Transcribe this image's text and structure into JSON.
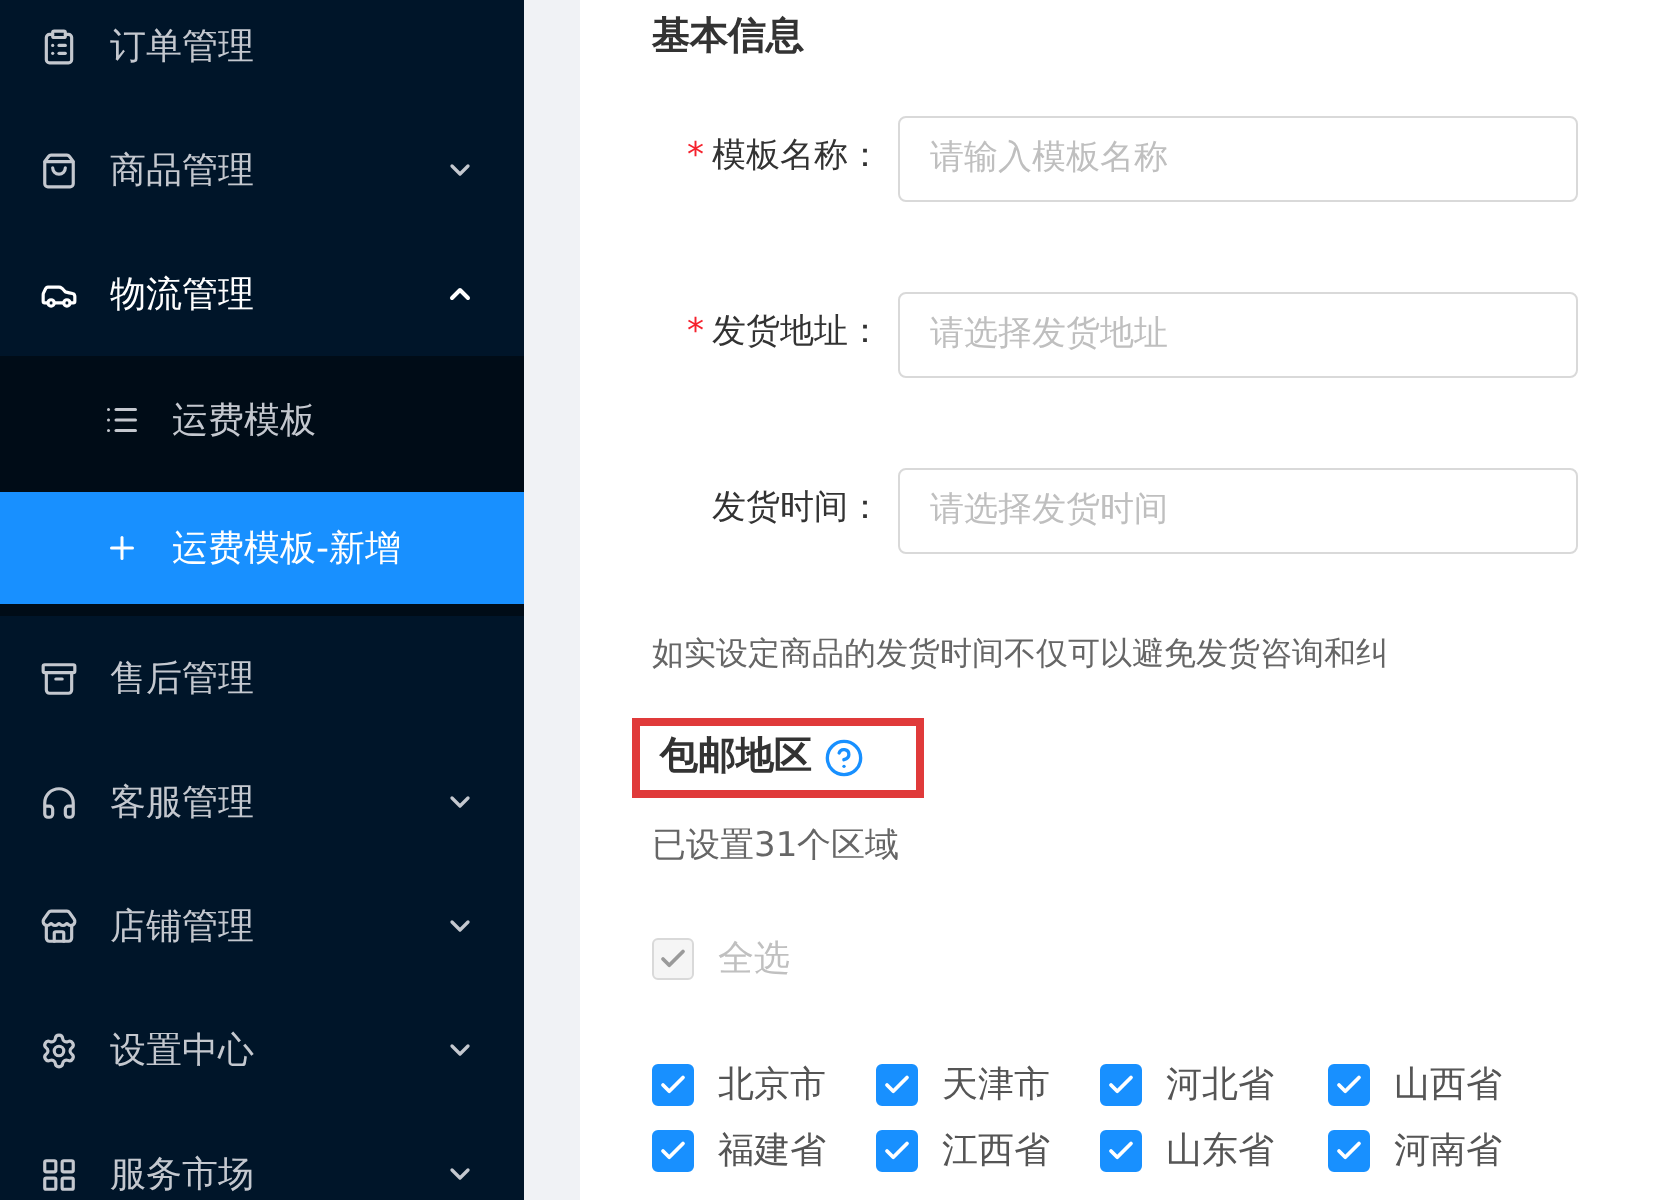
{
  "sidebar": {
    "items": [
      {
        "label": "订单管理"
      },
      {
        "label": "商品管理",
        "expanded": false
      },
      {
        "label": "物流管理",
        "expanded": true,
        "children": [
          {
            "label": "运费模板",
            "selected": false
          },
          {
            "label": "运费模板-新增",
            "selected": true
          }
        ]
      },
      {
        "label": "售后管理"
      },
      {
        "label": "客服管理",
        "expanded": false
      },
      {
        "label": "店铺管理",
        "expanded": false
      },
      {
        "label": "设置中心",
        "expanded": false
      },
      {
        "label": "服务市场",
        "expanded": false
      }
    ]
  },
  "form": {
    "title": "基本信息",
    "fields": [
      {
        "required_mark": "*",
        "label": "模板名称：",
        "placeholder": "请输入模板名称"
      },
      {
        "required_mark": "*",
        "label": "发货地址：",
        "placeholder": "请选择发货地址"
      },
      {
        "label": "发货时间：",
        "placeholder": "请选择发货时间"
      }
    ],
    "hint": "如实设定商品的发货时间不仅可以避免发货咨询和纠"
  },
  "free_shipping": {
    "title": "包邮地区",
    "highlighted": true,
    "summary": "已设置31个区域",
    "select_all": {
      "label": "全选",
      "checked": true,
      "disabled": true
    },
    "regions": [
      {
        "label": "北京市",
        "checked": true
      },
      {
        "label": "天津市",
        "checked": true
      },
      {
        "label": "河北省",
        "checked": true
      },
      {
        "label": "山西省",
        "checked": true
      },
      {
        "label": "福建省",
        "checked": true
      },
      {
        "label": "江西省",
        "checked": true
      },
      {
        "label": "山东省",
        "checked": true
      },
      {
        "label": "河南省",
        "checked": true
      }
    ]
  }
}
